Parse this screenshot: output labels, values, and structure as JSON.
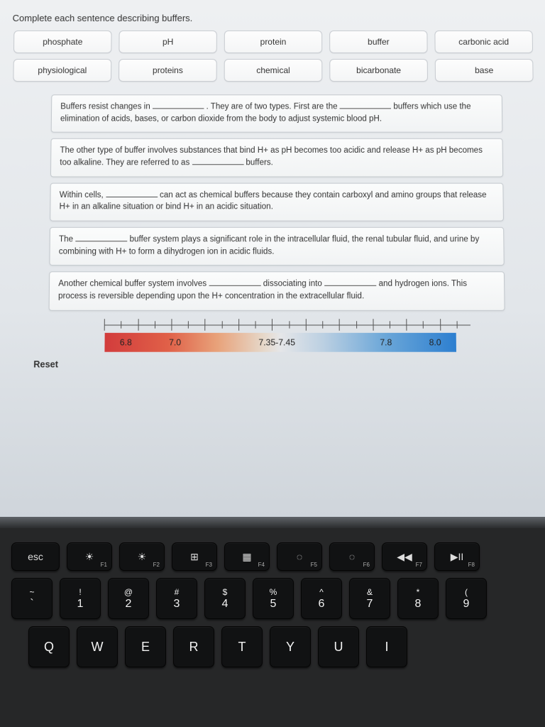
{
  "instruction": "Complete each sentence describing buffers.",
  "word_bank": [
    "phosphate",
    "pH",
    "protein",
    "buffer",
    "carbonic acid",
    "physiological",
    "proteins",
    "chemical",
    "bicarbonate",
    "base"
  ],
  "statements": {
    "s1a": "Buffers resist changes in ",
    "s1b": " . They are of two types. First are the ",
    "s1c": " buffers which use the elimination of acids, bases, or carbon dioxide from the body to adjust systemic blood pH.",
    "s2a": "The other type of buffer involves substances that bind H+ as pH becomes too acidic and release H+ as pH becomes too alkaline. They are referred to as ",
    "s2b": " buffers.",
    "s3a": "Within cells, ",
    "s3b": " can act as chemical buffers because they contain carboxyl and amino groups that release H+ in an alkaline situation or bind H+ in an acidic situation.",
    "s4a": "The ",
    "s4b": " buffer system plays a significant role in the intracellular fluid, the renal tubular fluid, and urine by combining with H+ to form a dihydrogen ion in acidic fluids.",
    "s5a": "Another chemical buffer system involves ",
    "s5b": " dissociating into ",
    "s5c": " and hydrogen ions. This process is reversible depending upon the H+ concentration in the extracellular fluid."
  },
  "ph_scale": {
    "labels": [
      "6.8",
      "7.0",
      "7.35-7.45",
      "7.8",
      "8.0"
    ],
    "positions_pct": [
      6,
      20,
      49,
      80,
      94
    ]
  },
  "reset_label": "Reset",
  "keyboard": {
    "fn_row": [
      {
        "main": "esc",
        "sub": ""
      },
      {
        "main": "☀",
        "sub": "F1",
        "dim": true
      },
      {
        "main": "☀",
        "sub": "F2"
      },
      {
        "main": "⊞",
        "sub": "F3"
      },
      {
        "main": "▦",
        "sub": "F4"
      },
      {
        "main": "◌",
        "sub": "F5"
      },
      {
        "main": "◌",
        "sub": "F6"
      },
      {
        "main": "◀◀",
        "sub": "F7"
      },
      {
        "main": "▶II",
        "sub": "F8"
      }
    ],
    "num_row": [
      {
        "top": "~",
        "bot": "`"
      },
      {
        "top": "!",
        "bot": "1"
      },
      {
        "top": "@",
        "bot": "2"
      },
      {
        "top": "#",
        "bot": "3"
      },
      {
        "top": "$",
        "bot": "4"
      },
      {
        "top": "%",
        "bot": "5"
      },
      {
        "top": "^",
        "bot": "6"
      },
      {
        "top": "&",
        "bot": "7"
      },
      {
        "top": "*",
        "bot": "8"
      },
      {
        "top": "(",
        "bot": "9"
      }
    ],
    "letter_row": [
      "Q",
      "W",
      "E",
      "R",
      "T",
      "Y",
      "U",
      "I"
    ]
  }
}
